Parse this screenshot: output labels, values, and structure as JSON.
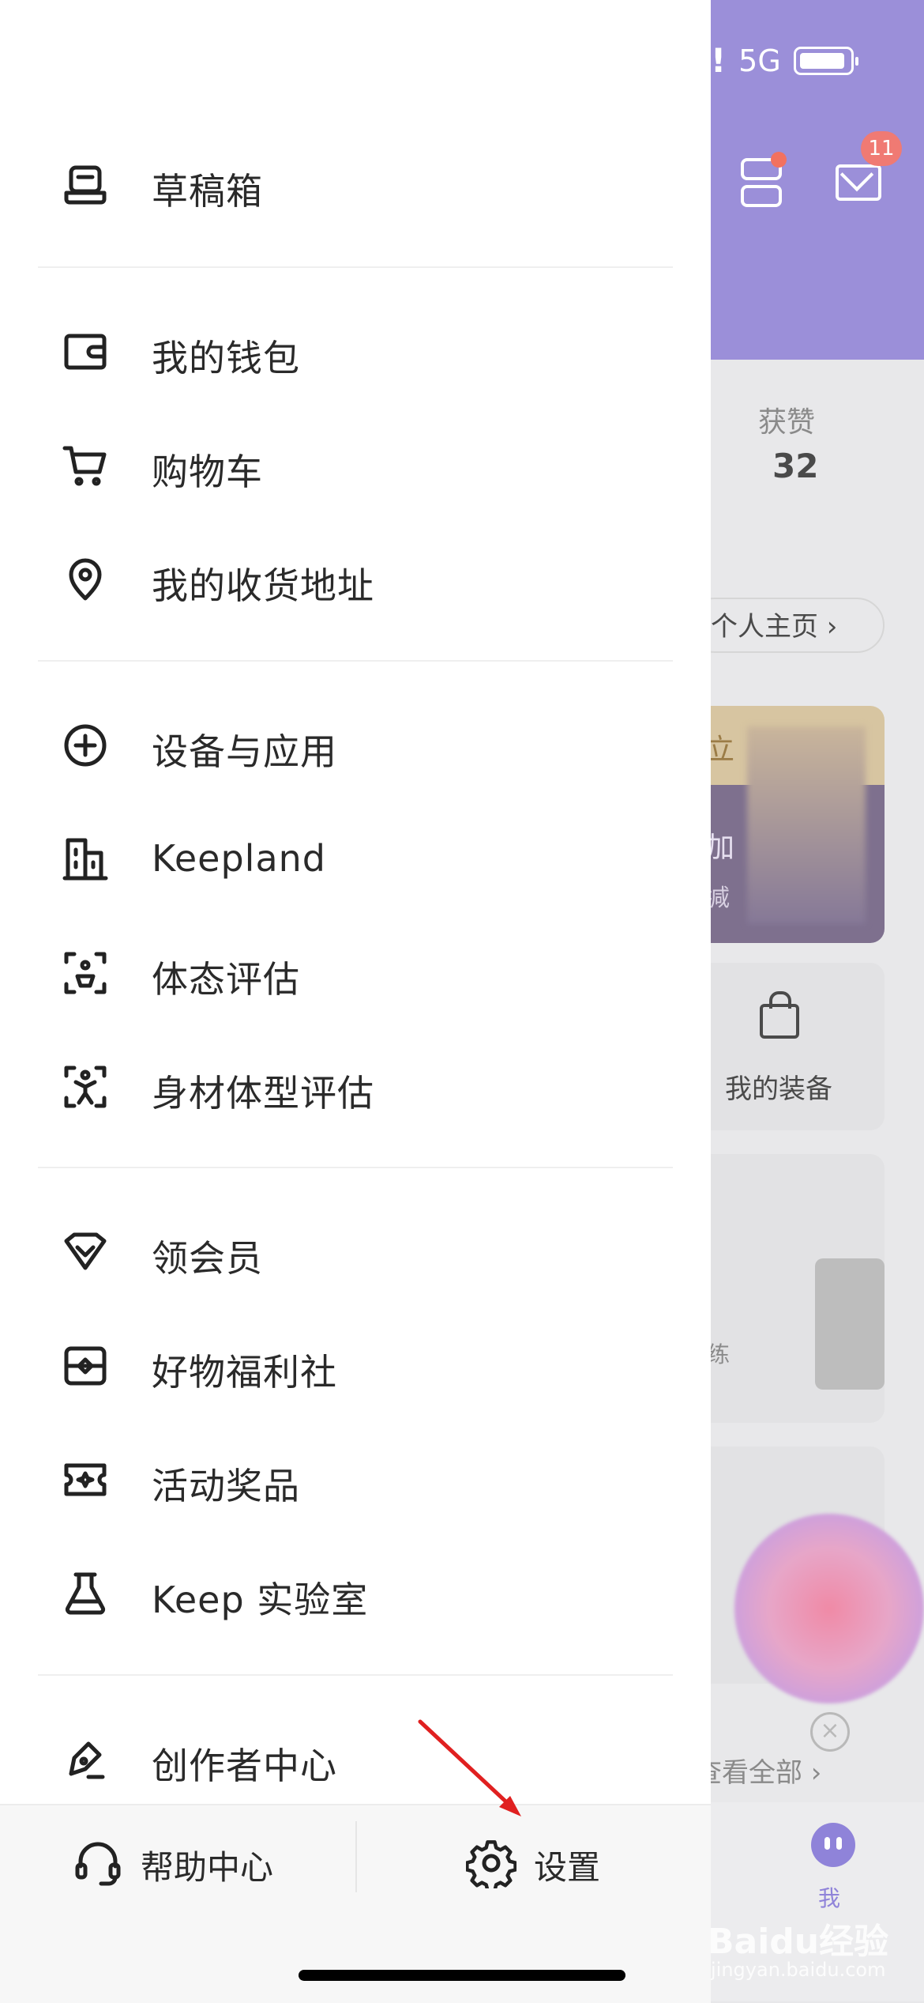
{
  "background": {
    "status": {
      "network": "5G"
    },
    "header": {
      "message_badge": "11"
    },
    "stats": {
      "likes_label": "获赞",
      "likes_value": "32"
    },
    "profile_link": "个人主页",
    "promo": {
      "line1": "立",
      "line2": "加",
      "line3": "减"
    },
    "equipment_label": "我的装备",
    "partial_text": "练",
    "view_all": "查看全部",
    "tab_label": "我",
    "watermark": "Baidu经验",
    "watermark_sub": "jingyan.baidu.com"
  },
  "drawer": {
    "sections": [
      [
        {
          "label": "草稿箱",
          "icon": "drafts-icon"
        }
      ],
      [
        {
          "label": "我的钱包",
          "icon": "wallet-icon"
        },
        {
          "label": "购物车",
          "icon": "cart-icon"
        },
        {
          "label": "我的收货地址",
          "icon": "location-pin-icon"
        }
      ],
      [
        {
          "label": "设备与应用",
          "icon": "plus-circle-icon"
        },
        {
          "label": "Keepland",
          "icon": "building-icon"
        },
        {
          "label": "体态评估",
          "icon": "posture-scan-icon"
        },
        {
          "label": "身材体型评估",
          "icon": "body-scan-icon"
        }
      ],
      [
        {
          "label": "领会员",
          "icon": "vip-heart-icon"
        },
        {
          "label": "好物福利社",
          "icon": "goods-welfare-icon"
        },
        {
          "label": "活动奖品",
          "icon": "prize-ticket-icon"
        },
        {
          "label": "Keep 实验室",
          "icon": "flask-icon"
        }
      ],
      [
        {
          "label": "创作者中心",
          "icon": "creator-pen-icon"
        }
      ]
    ],
    "footer": {
      "help_label": "帮助中心",
      "settings_label": "设置"
    }
  }
}
